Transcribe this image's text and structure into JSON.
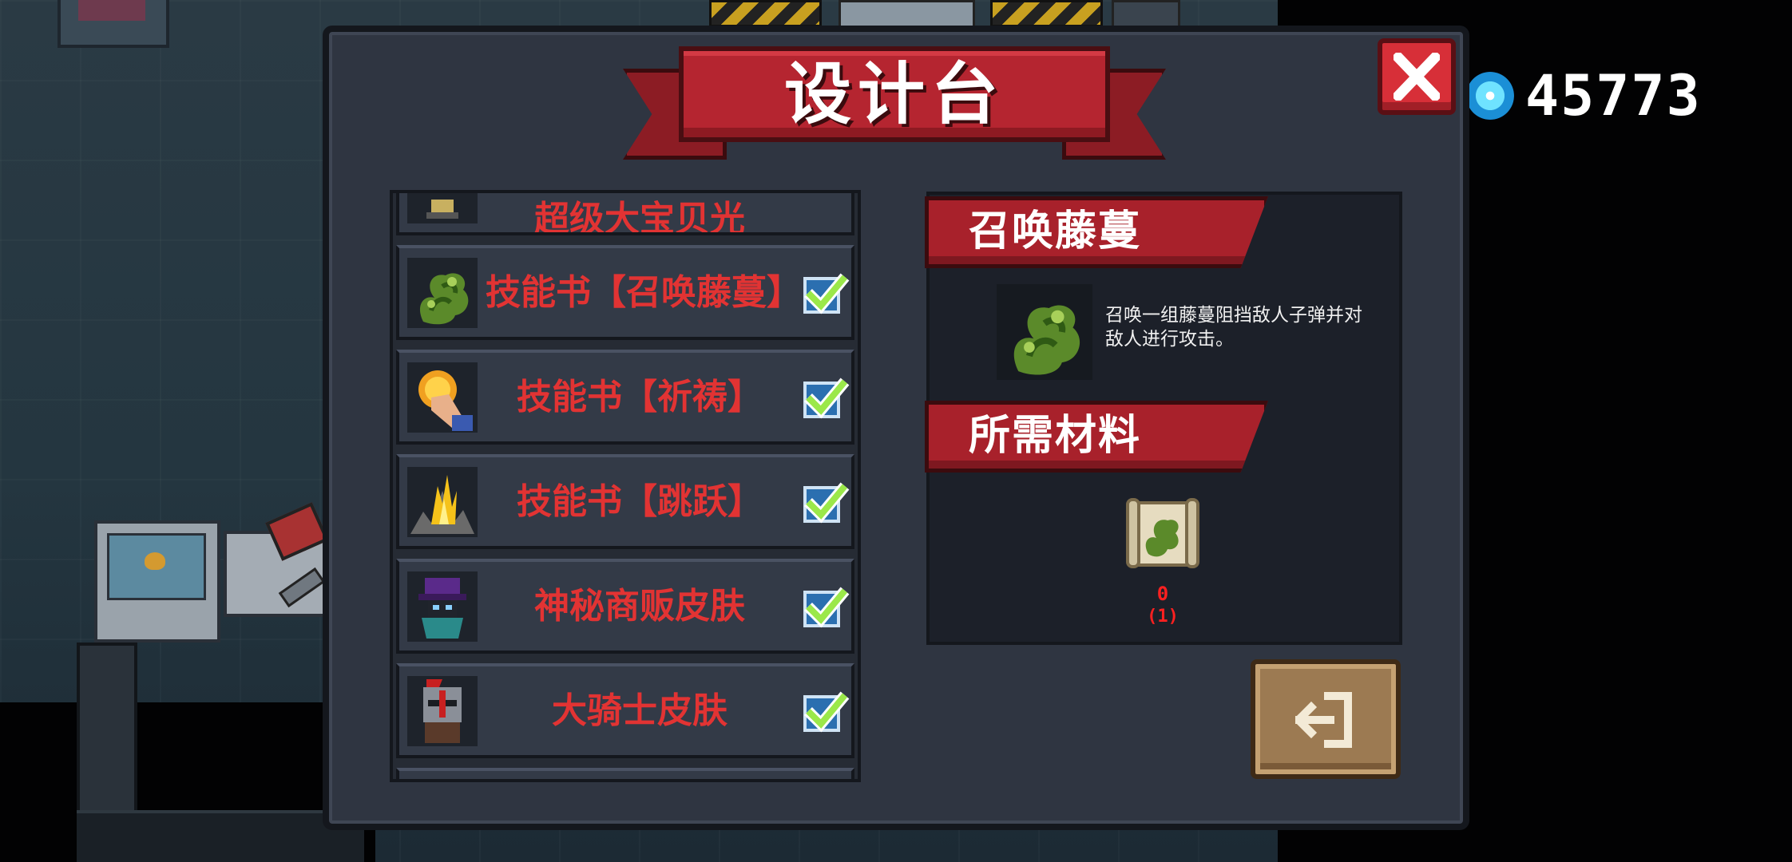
{
  "dialog": {
    "title": "设计台",
    "close_icon": "close-x-icon",
    "exit_icon": "exit-door-icon"
  },
  "currency": {
    "icon": "blue-gem-icon",
    "amount": "45773"
  },
  "list": {
    "partial_top_label": "超级大宝贝光",
    "items": [
      {
        "label": "技能书【召唤藤蔓】",
        "icon": "vine-monster-icon",
        "checked": true
      },
      {
        "label": "技能书【祈祷】",
        "icon": "praying-hand-icon",
        "checked": true
      },
      {
        "label": "技能书【跳跃】",
        "icon": "jump-blast-icon",
        "checked": true
      },
      {
        "label": "神秘商贩皮肤",
        "icon": "mystery-merchant-icon",
        "checked": true
      },
      {
        "label": "大骑士皮肤",
        "icon": "grand-knight-icon",
        "checked": true
      }
    ]
  },
  "detail": {
    "name": "召唤藤蔓",
    "icon": "vine-monster-icon",
    "description": "召唤一组藤蔓阻挡敌人子弹并对敌人进行攻击。",
    "materials_heading": "所需材料",
    "material": {
      "icon": "vine-scroll-icon",
      "owned": "0",
      "required": "(1)"
    }
  },
  "colors": {
    "panel": "#2f3541",
    "ribbon_red": "#b52530",
    "label_red": "#e23333",
    "check_green": "#9be84a",
    "exit_brown": "#9c7a52"
  }
}
